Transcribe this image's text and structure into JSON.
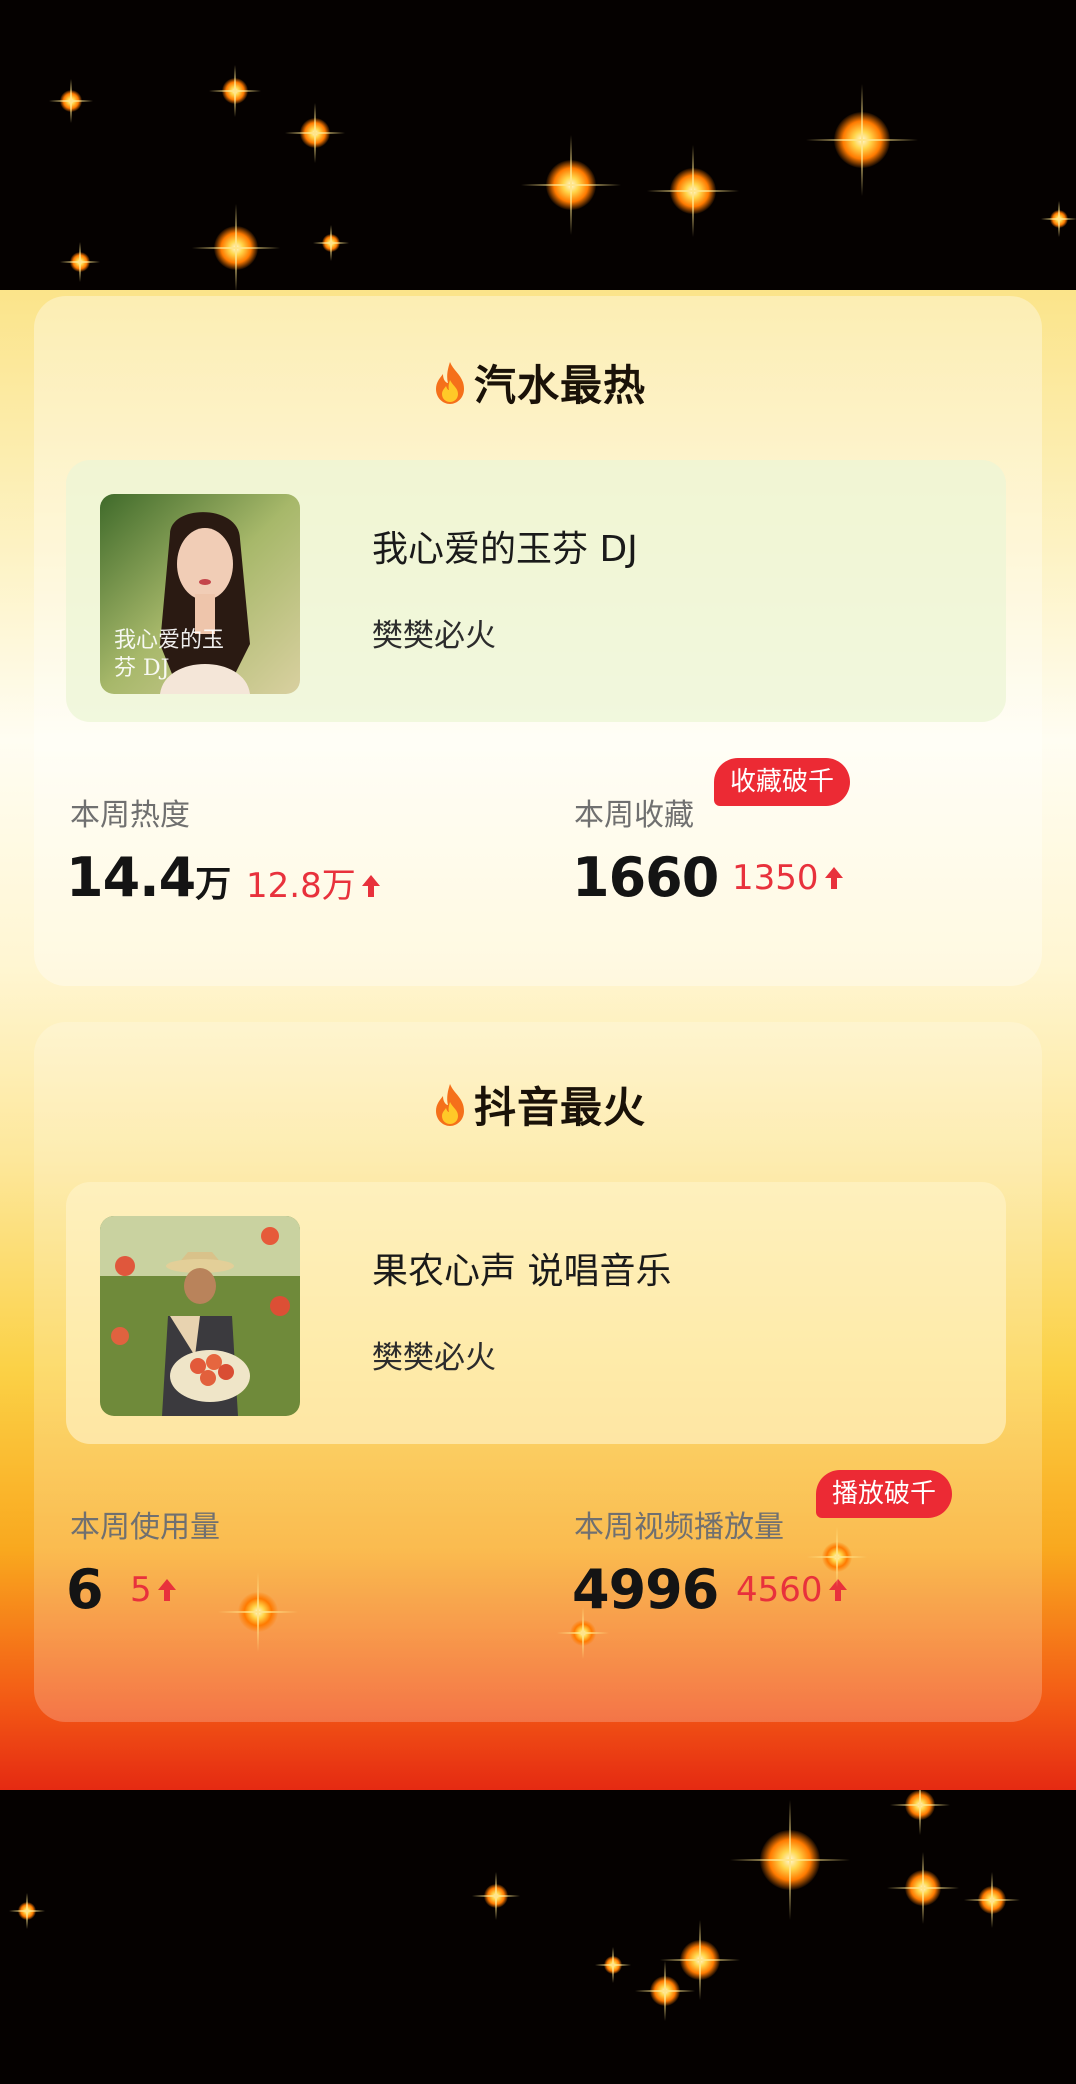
{
  "colors": {
    "accent_red": "#e8313c",
    "badge_red": "#ec2a34",
    "text_dark": "#141414",
    "label_gray": "#707070"
  },
  "sections": [
    {
      "title": "汽水最热",
      "icon": "fire-icon",
      "song": {
        "name": "我心爱的玉芬 DJ",
        "artist": "樊樊必火",
        "cover_text_line1": "我心爱的玉",
        "cover_text_line2": "芬 DJ"
      },
      "stats": [
        {
          "label": "本周热度",
          "value": "14.4",
          "unit": "万",
          "delta": "12.8万",
          "trend": "up"
        },
        {
          "label": "本周收藏",
          "value": "1660",
          "unit": "",
          "delta": "1350",
          "trend": "up",
          "badge": "收藏破千"
        }
      ]
    },
    {
      "title": "抖音最火",
      "icon": "fire-icon",
      "song": {
        "name": "果农心声 说唱音乐",
        "artist": "樊樊必火"
      },
      "stats": [
        {
          "label": "本周使用量",
          "value": "6",
          "unit": "",
          "delta": "5",
          "trend": "up"
        },
        {
          "label": "本周视频播放量",
          "value": "4996",
          "unit": "",
          "delta": "4560",
          "trend": "up",
          "badge": "播放破千"
        }
      ]
    }
  ]
}
